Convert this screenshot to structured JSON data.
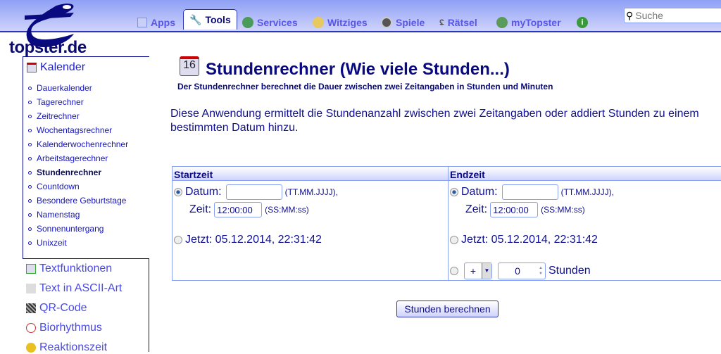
{
  "site": {
    "logo": "topster.de"
  },
  "nav": {
    "tabs": [
      {
        "label": "Apps"
      },
      {
        "label": "Tools"
      },
      {
        "label": "Services"
      },
      {
        "label": "Witziges"
      },
      {
        "label": "Spiele"
      },
      {
        "label": "Rätsel"
      },
      {
        "label": "myTopster"
      }
    ],
    "search_placeholder": "Suche"
  },
  "sidebar": {
    "section": "Kalender",
    "items": [
      "Dauerkalender",
      "Tagerechner",
      "Zeitrechner",
      "Wochentagsrechner",
      "Kalenderwochenrechner",
      "Arbeitstagerechner",
      "Stundenrechner",
      "Countdown",
      "Besondere Geburtstage",
      "Namenstag",
      "Sonnenuntergang",
      "Unixzeit"
    ],
    "other": [
      "Textfunktionen",
      "Text in ASCII-Art",
      "QR-Code",
      "Biorhythmus",
      "Reaktionszeit"
    ]
  },
  "main": {
    "title": "Stundenrechner (Wie viele Stunden...)",
    "subtitle": "Der Stundenrechner berechnet die Dauer zwischen zwei Zeitangaben in Stunden und Minuten",
    "intro": "Diese Anwendung ermittelt die Stundenanzahl zwischen zwei Zeitangaben oder addiert Stunden zu einem bestimmten Datum hinzu.",
    "start": {
      "header": "Startzeit",
      "datum_label": "Datum:",
      "datum_value": "",
      "datum_hint": "(TT.MM.JJJJ),",
      "zeit_label": "Zeit:",
      "zeit_value": "12:00:00",
      "zeit_hint": "(SS:MM:ss)",
      "jetzt": "Jetzt: 05.12.2014, 22:31:42"
    },
    "end": {
      "header": "Endzeit",
      "datum_label": "Datum:",
      "datum_value": "",
      "datum_hint": "(TT.MM.JJJJ),",
      "zeit_label": "Zeit:",
      "zeit_value": "12:00:00",
      "zeit_hint": "(SS:MM:ss)",
      "jetzt": "Jetzt: 05.12.2014, 22:31:42",
      "op": "+",
      "hours": "0",
      "hours_label": "Stunden"
    },
    "button": "Stunden berechnen"
  }
}
